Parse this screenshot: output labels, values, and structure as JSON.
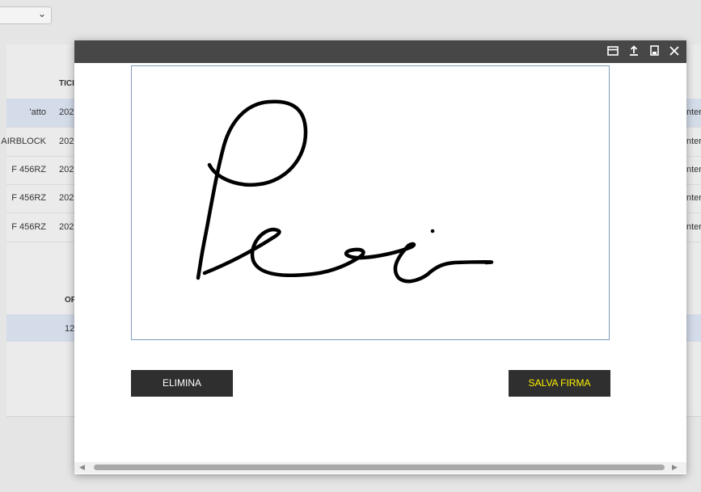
{
  "background": {
    "select_chevron": "⌄",
    "header_col": "TICI",
    "rows": [
      {
        "col1": "'atto",
        "col2": "202",
        "col3": "nter",
        "highlighted": true
      },
      {
        "col1": "AIRBLOCK",
        "col2": "202",
        "col3": "nter",
        "highlighted": false
      },
      {
        "col1": "F 456RZ",
        "col2": "202",
        "col3": "nter",
        "highlighted": false
      },
      {
        "col1": "F 456RZ",
        "col2": "202",
        "col3": "nter",
        "highlighted": false
      },
      {
        "col1": "F 456RZ",
        "col2": "202",
        "col3": "nter",
        "highlighted": false
      }
    ],
    "header2_col": "OF",
    "row2_value": "12"
  },
  "modal": {
    "titlebar_icons": [
      "window-icon",
      "upload-icon",
      "save-icon",
      "close-icon"
    ],
    "buttons": {
      "delete_label": "ELIMINA",
      "save_label": "SALVA FIRMA"
    },
    "colors": {
      "titlebar": "#474747",
      "button_bg": "#2f2f2f",
      "save_text": "#fff200"
    }
  }
}
